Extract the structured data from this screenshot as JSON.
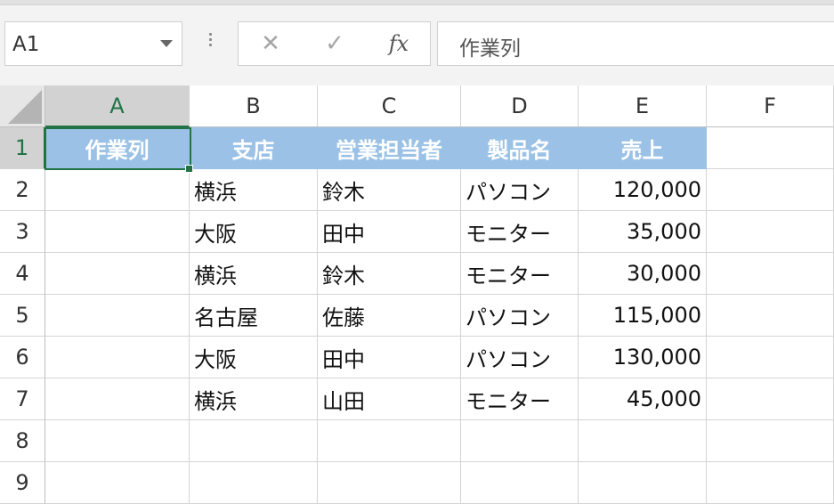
{
  "name_box": {
    "value": "A1"
  },
  "formula_bar": {
    "cancel_icon": "✕",
    "enter_icon": "✓",
    "fx_label": "fx",
    "content": "作業列"
  },
  "columns": [
    "A",
    "B",
    "C",
    "D",
    "E",
    "F"
  ],
  "rows": [
    "1",
    "2",
    "3",
    "4",
    "5",
    "6",
    "7",
    "8",
    "9"
  ],
  "cells": [
    [
      "作業列",
      "支店",
      "営業担当者",
      "製品名",
      "売上",
      ""
    ],
    [
      "",
      "横浜",
      "鈴木",
      "パソコン",
      "120,000",
      ""
    ],
    [
      "",
      "大阪",
      "田中",
      "モニター",
      "35,000",
      ""
    ],
    [
      "",
      "横浜",
      "鈴木",
      "モニター",
      "30,000",
      ""
    ],
    [
      "",
      "名古屋",
      "佐藤",
      "パソコン",
      "115,000",
      ""
    ],
    [
      "",
      "大阪",
      "田中",
      "パソコン",
      "130,000",
      ""
    ],
    [
      "",
      "横浜",
      "山田",
      "モニター",
      "45,000",
      ""
    ],
    [
      "",
      "",
      "",
      "",
      "",
      ""
    ],
    [
      "",
      "",
      "",
      "",
      "",
      ""
    ]
  ],
  "selected_cell": "A1",
  "colors": {
    "header_fill": "#9bc2e6",
    "selection": "#217346"
  }
}
